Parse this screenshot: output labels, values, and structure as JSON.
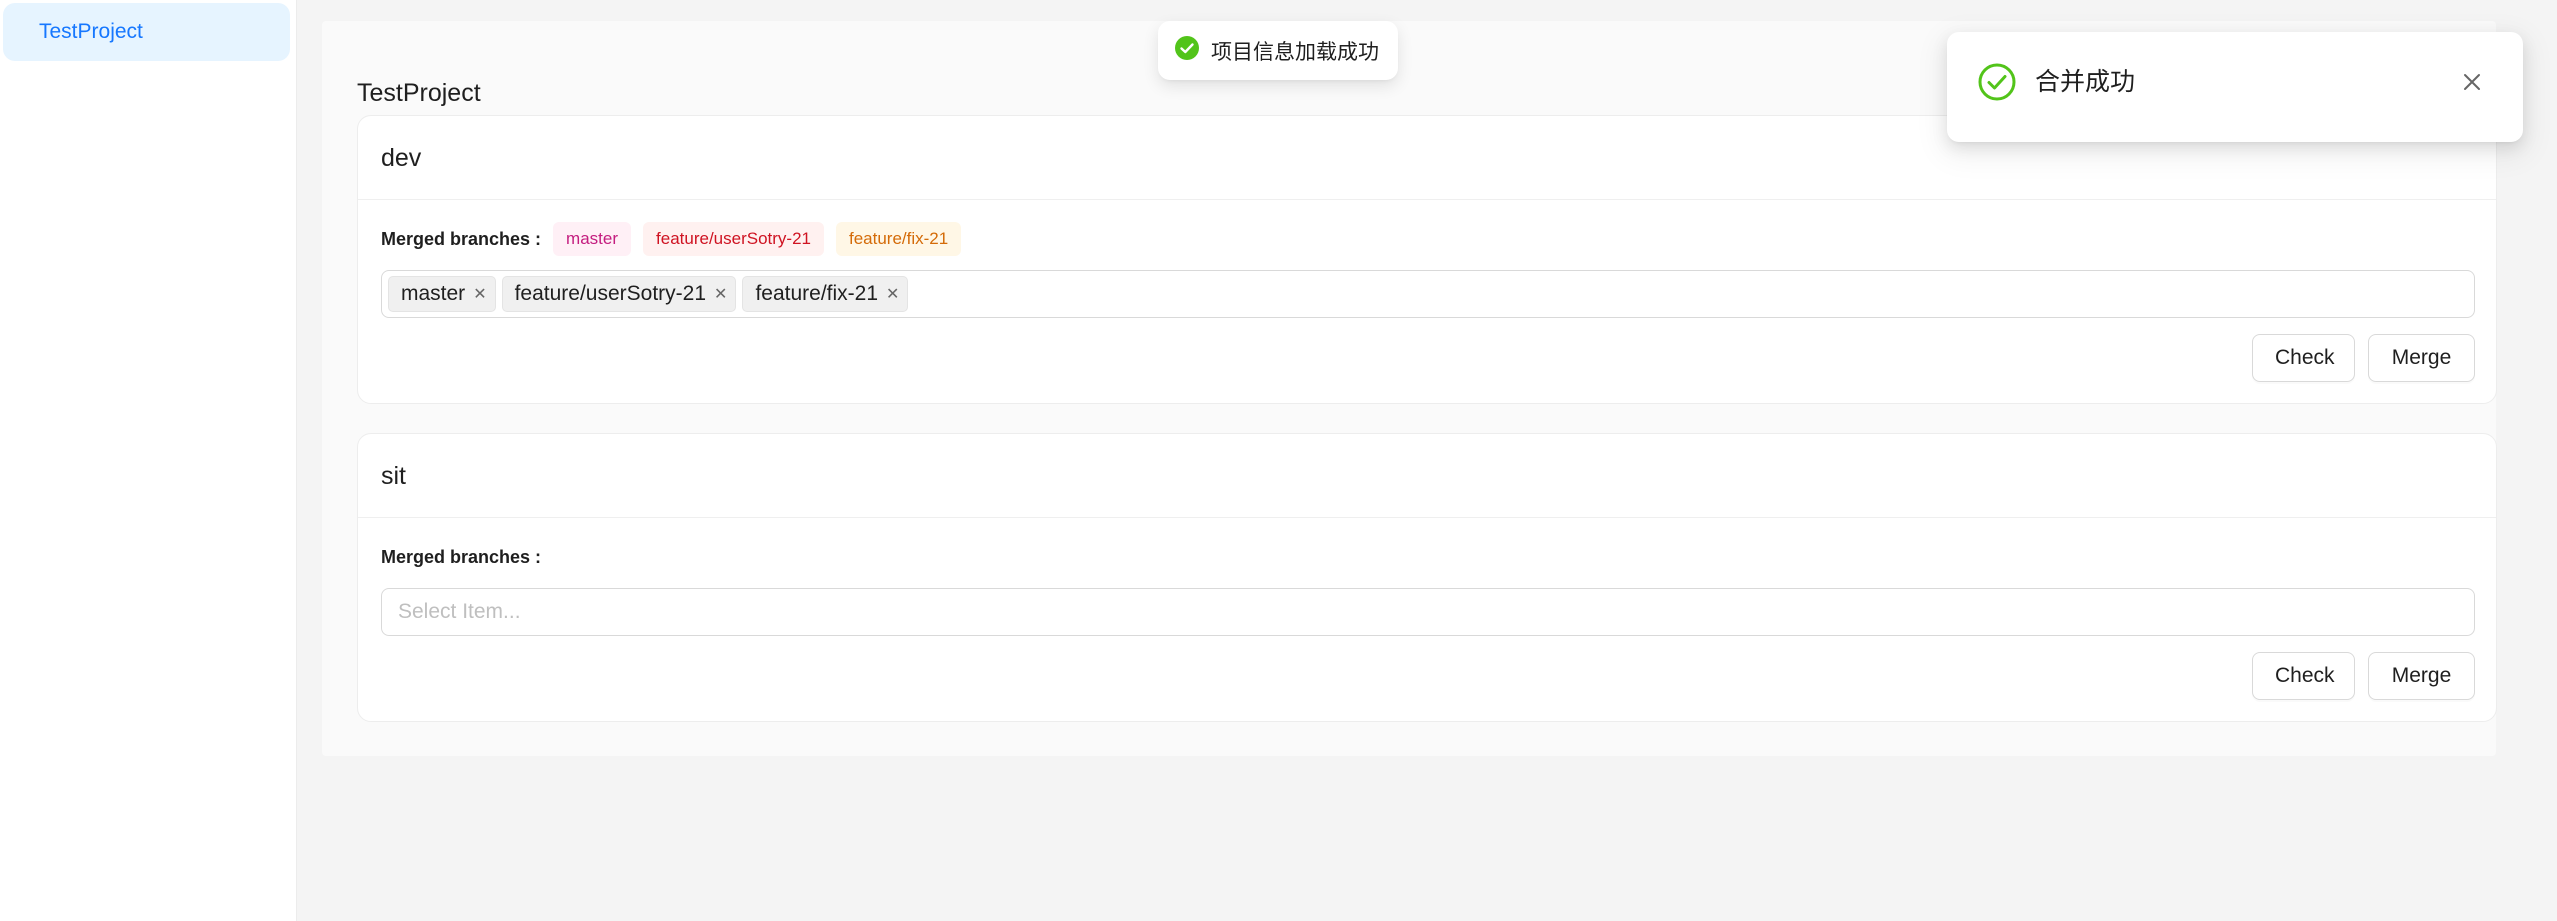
{
  "sidebar": {
    "items": [
      {
        "label": "TestProject",
        "active": true
      }
    ]
  },
  "main": {
    "project_title": "TestProject",
    "environments": [
      {
        "name": "dev",
        "merged_label": "Merged branches :",
        "merged_tags": [
          {
            "label": "master",
            "color": "magenta"
          },
          {
            "label": "feature/userSotry-21",
            "color": "red"
          },
          {
            "label": "feature/fix-21",
            "color": "orange"
          }
        ],
        "selected": [
          "master",
          "feature/userSotry-21",
          "feature/fix-21"
        ],
        "placeholder": "Select Item...",
        "check_label": "Check",
        "merge_label": "Merge"
      },
      {
        "name": "sit",
        "merged_label": "Merged branches :",
        "merged_tags": [],
        "selected": [],
        "placeholder": "Select Item...",
        "check_label": "Check",
        "merge_label": "Merge"
      }
    ]
  },
  "toast": {
    "text": "项目信息加载成功",
    "icon": "check-circle-filled-icon"
  },
  "notification": {
    "text": "合并成功",
    "icon": "check-circle-outline-icon"
  },
  "colors": {
    "accent": "#1677ff",
    "success": "#52c41a",
    "sidebar_active_bg": "#e6f4ff"
  }
}
